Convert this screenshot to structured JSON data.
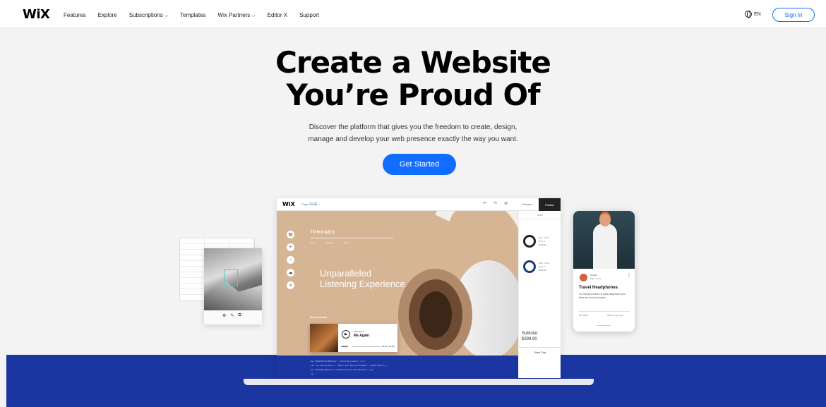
{
  "nav": {
    "logo": "WiX",
    "items": [
      {
        "label": "Features",
        "has_dropdown": false
      },
      {
        "label": "Explore",
        "has_dropdown": false
      },
      {
        "label": "Subscriptions",
        "has_dropdown": true
      },
      {
        "label": "Templates",
        "has_dropdown": false
      },
      {
        "label": "Wix Partners",
        "has_dropdown": true
      },
      {
        "label": "Editor X",
        "has_dropdown": false
      },
      {
        "label": "Support",
        "has_dropdown": false
      }
    ],
    "language": "EN",
    "sign_in": "Sign In",
    "chevron_glyph": "⌵"
  },
  "hero": {
    "title_line1": "Create a Website",
    "title_line2": "You’re Proud Of",
    "subtitle_line1": "Discover the platform that gives you the freedom to create, design,",
    "subtitle_line2": "manage and develop your web presence exactly the way you want.",
    "cta": "Get Started"
  },
  "colors": {
    "accent": "#116dff",
    "band": "#1c36a1",
    "canvas": "#d6b595"
  },
  "editor": {
    "logo": "WiX",
    "page_label": "Page: Home ⌵",
    "preview": "Preview",
    "publish": "Publish",
    "site": {
      "brand": "TPHONES",
      "menu": [
        "Home",
        "Reviews",
        "Shop"
      ],
      "headline_line1": "Unparalleled",
      "headline_line2": "Listening Experience",
      "new_arrivals": "New Arrivals"
    },
    "player": {
      "artist": "Jake Blind",
      "song": "Me Again",
      "time": "00:20 / 03:36"
    },
    "cart": {
      "header": "CART",
      "items": [
        {
          "line1": "Item · Price",
          "line2": "QTY: 1",
          "line3": "$199.95"
        },
        {
          "line1": "Item · Price",
          "line2": "QTY: 1",
          "line3": "$199.95"
        }
      ],
      "subtotal_label": "Subtotal",
      "subtotal_value": "$399.90",
      "view_cart": "View Cart"
    },
    "code_lines": [
      "$w('#addToCartButton').onClick((event) => {",
      "    let currentProduct = await $w('#productPage1').getProduct();",
      "    $w('#shoppingCart').addToCart(currentProduct._id)",
      "});"
    ]
  },
  "phone": {
    "user_name": "Nicolas",
    "user_sub": "Sun • 2 min",
    "post_title": "Travel Headphones",
    "post_body": "I’ve reviewed dozens of pairs headphones and these are my top five picks",
    "views": "257 views",
    "comment": "Write a comment"
  }
}
